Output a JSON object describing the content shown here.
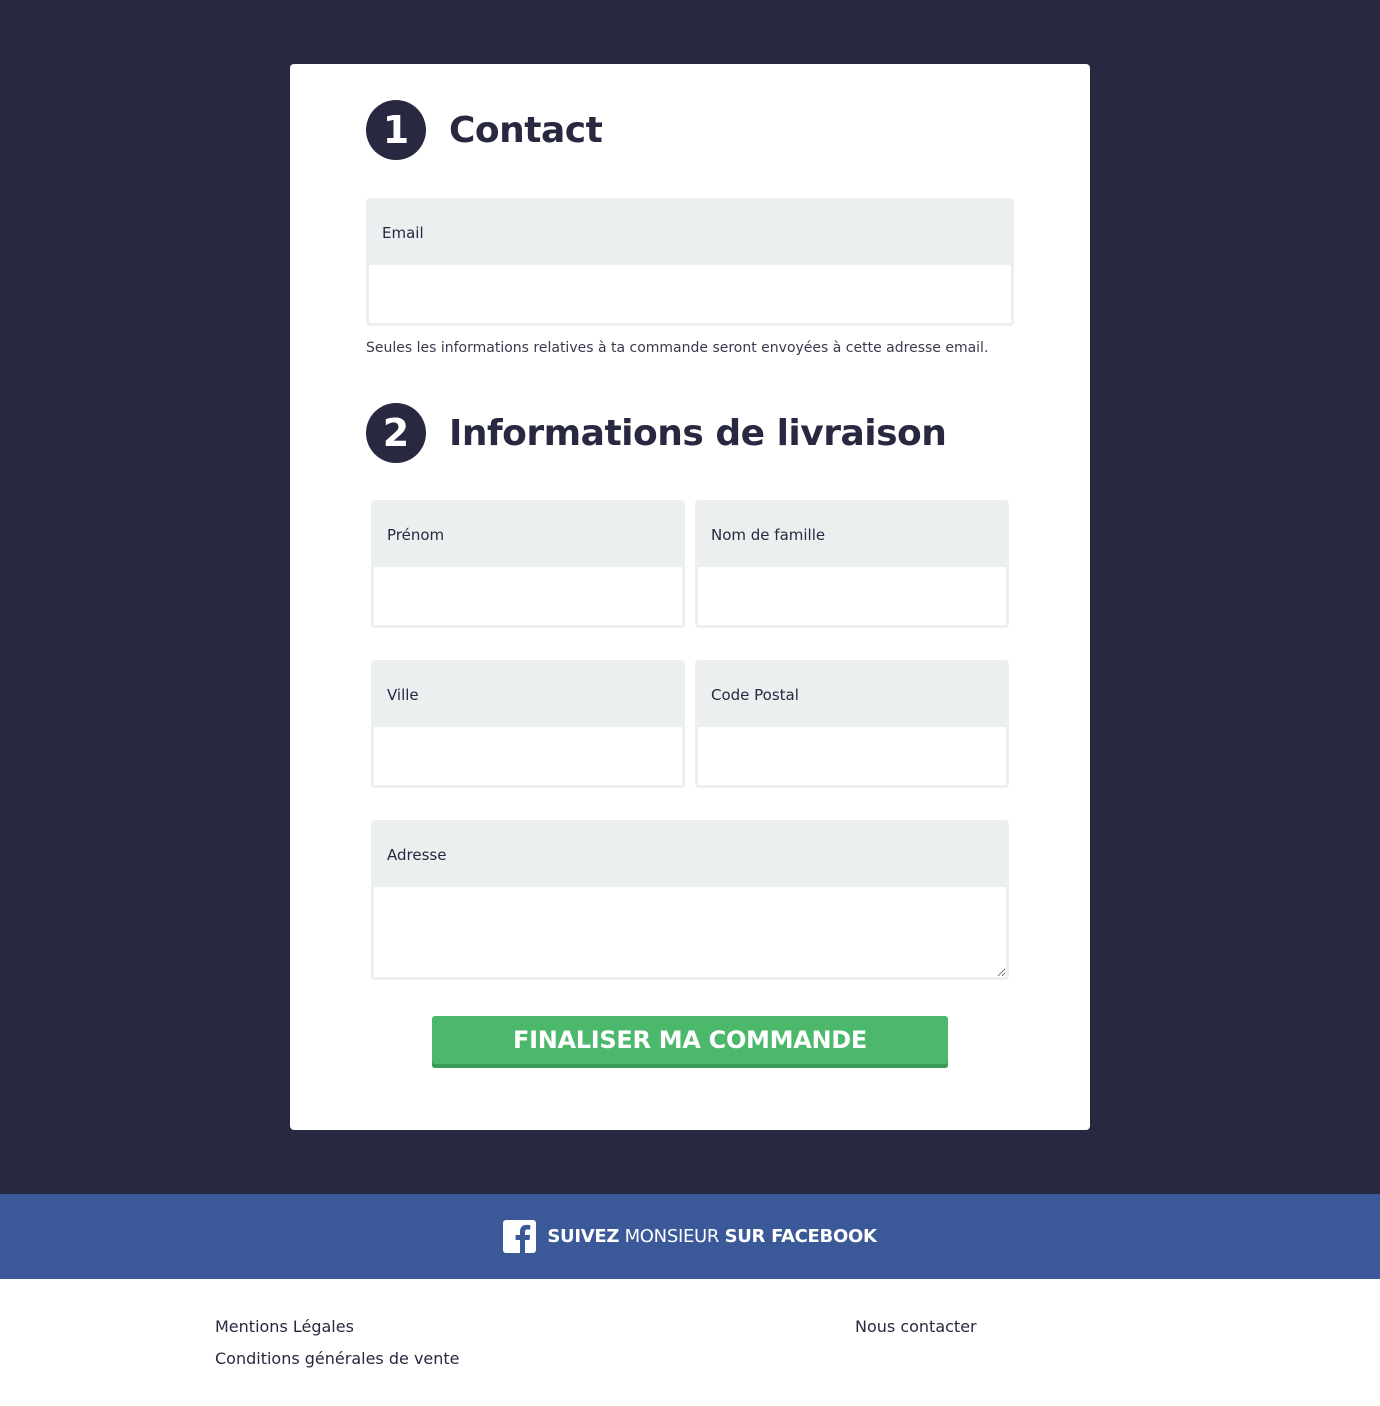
{
  "contact": {
    "step_number": "1",
    "title": "Contact",
    "email_label": "Email",
    "email_value": "",
    "hint": "Seules les informations relatives à ta commande seront envoyées à cette adresse email."
  },
  "shipping": {
    "step_number": "2",
    "title": "Informations de livraison",
    "first_name_label": "Prénom",
    "first_name_value": "",
    "last_name_label": "Nom de famille",
    "last_name_value": "",
    "city_label": "Ville",
    "city_value": "",
    "postal_code_label": "Code Postal",
    "postal_code_value": "",
    "address_label": "Adresse",
    "address_value": ""
  },
  "submit": {
    "label": "FINALISER MA COMMANDE"
  },
  "facebook": {
    "icon": "facebook-icon",
    "text_bold_1": "SUIVEZ",
    "text_regular": "MONSIEUR",
    "text_bold_2": "SUR FACEBOOK"
  },
  "footer": {
    "legal_label": "Mentions Légales",
    "terms_label": "Conditions générales de vente",
    "contact_label": "Nous contacter"
  },
  "colors": {
    "page_background": "#282840",
    "card_background": "#ffffff",
    "field_label_background": "#eceff0",
    "submit_button": "#4cb86c",
    "facebook_bar": "#3b5998"
  }
}
